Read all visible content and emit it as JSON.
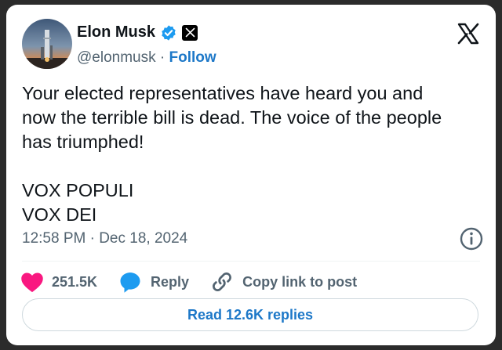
{
  "author": {
    "name": "Elon Musk",
    "handle": "@elonmusk",
    "separator": " · ",
    "follow_label": "Follow"
  },
  "tweet": {
    "text": "Your elected representatives have heard you and\nnow the terrible bill is dead. The voice of the people\nhas triumphed!\n\nVOX POPULI\nVOX DEI",
    "timestamp": "12:58 PM · Dec 18, 2024"
  },
  "actions": {
    "likes": "251.5K",
    "reply_label": "Reply",
    "copy_link_label": "Copy link to post"
  },
  "read_replies_label": "Read 12.6K replies",
  "colors": {
    "accent": "#1d9bf0",
    "link": "#1d78c8",
    "heart": "#f91880",
    "muted": "#536471",
    "text": "#0f1419"
  },
  "icons": [
    "verified-icon",
    "x-badge-icon",
    "x-logo-icon",
    "info-icon",
    "heart-icon",
    "reply-icon",
    "link-icon"
  ]
}
